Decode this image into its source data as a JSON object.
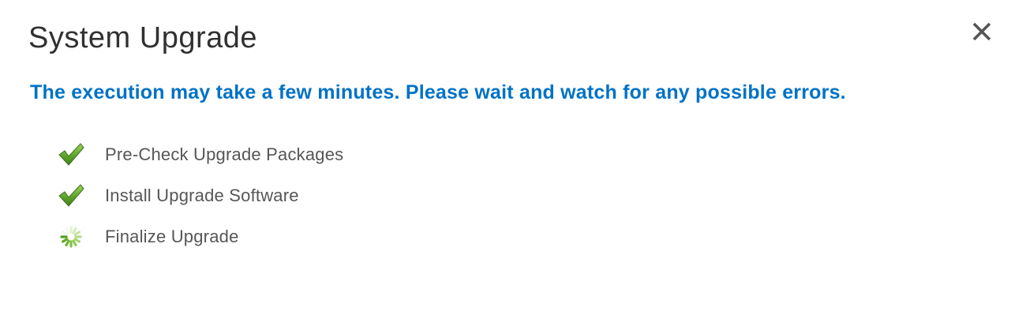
{
  "dialog": {
    "title": "System Upgrade",
    "message": "The execution may take a few minutes. Please wait and watch for any possible errors.",
    "close_icon": "close-icon",
    "accent_color": "#0072c6"
  },
  "steps": [
    {
      "label": "Pre-Check Upgrade Packages",
      "status": "completed",
      "icon": "green-checkmark-icon"
    },
    {
      "label": "Install Upgrade Software",
      "status": "completed",
      "icon": "green-checkmark-icon"
    },
    {
      "label": "Finalize Upgrade",
      "status": "in-progress",
      "icon": "loading-spinner-icon"
    }
  ]
}
